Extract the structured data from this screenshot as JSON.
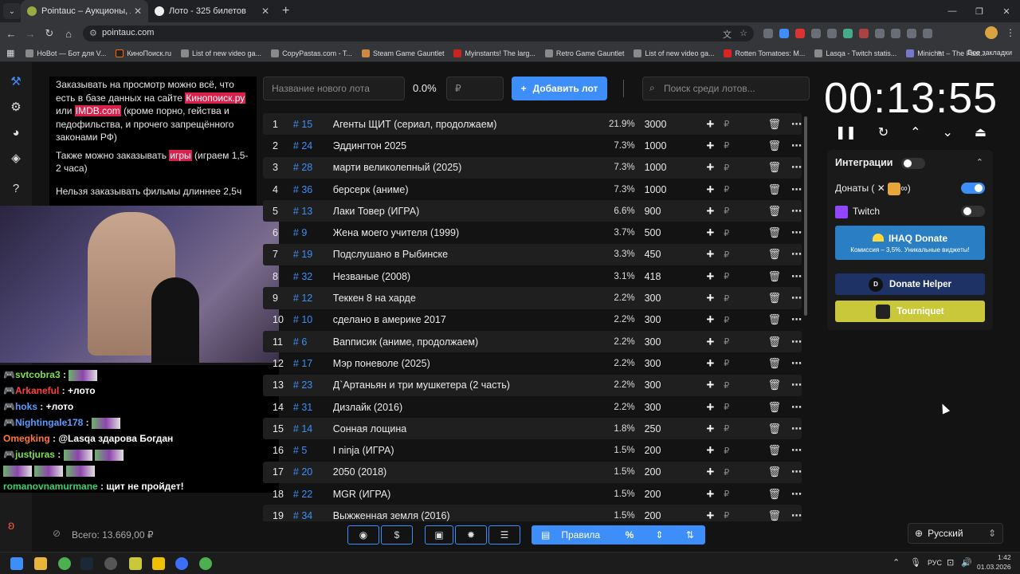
{
  "browser": {
    "tabs": [
      {
        "title": "Pointauc – Аукционы, лотереи",
        "active": true
      },
      {
        "title": "Лото - 325 билетов",
        "active": false
      }
    ],
    "new_tab": "+",
    "url": "pointauc.com",
    "bookmarks": [
      "HoBot — Бот для V...",
      "КиноПоиск.ru",
      "List of new video ga...",
      "CopyPastas.com - T...",
      "Steam Game Gauntlet",
      "Myinstants! The larg...",
      "Retro Game Gauntlet",
      "List of new video ga...",
      "Rotten Tomatoes: M...",
      "Lasqa - Twitch statis...",
      "Minichat – The Fast..."
    ],
    "all_bookmarks": "Все закладки"
  },
  "rules_panel": {
    "p1_before": "Заказывать на просмотр можно всё, что есть в базе данных на сайте ",
    "p1_link1": "Кинопоиск.ру",
    "p1_mid": " или ",
    "p1_link2": "IMDB.com",
    "p1_after": " (кроме порно, гейства и педофильства, и прочего запрещённого законами РФ)",
    "p2_before": "Также можно заказывать ",
    "p2_link": "игры",
    "p2_after": " (играем 1,5-2 часа)",
    "p3": "Нельзя заказывать фильмы длиннее 2,5ч"
  },
  "chat": [
    {
      "user": "svtcobra3",
      "color": "#7fe04d",
      "msg": ""
    },
    {
      "user": "Arkaneful",
      "color": "#ff4040",
      "msg": "+лото"
    },
    {
      "user": "hoks",
      "color": "#5a9cff",
      "msg": "+лото"
    },
    {
      "user": "Nightingale178",
      "color": "#5a9cff",
      "msg": ""
    },
    {
      "user": "Omegking",
      "color": "#ff7a30",
      "msg": "@Lasqa здарова Богдан"
    },
    {
      "user": "justjuras",
      "color": "#7fe04d",
      "msg": ""
    },
    {
      "user": "romanovnamurmane",
      "color": "#3cd070",
      "msg": "щит не пройдет!"
    }
  ],
  "top_controls": {
    "new_lot_placeholder": "Название нового лота",
    "percent": "0.0%",
    "amount_placeholder": "₽",
    "add_lot": "Добавить лот",
    "search_placeholder": "Поиск среди лотов..."
  },
  "lots": [
    {
      "n": "1",
      "id": "# 15",
      "name": "Агенты ЩИТ (сериал, продолжаем)",
      "pct": "21.9%",
      "amount": "3000"
    },
    {
      "n": "2",
      "id": "# 24",
      "name": "Эддингтон 2025",
      "pct": "7.3%",
      "amount": "1000"
    },
    {
      "n": "3",
      "id": "# 28",
      "name": "марти великолепный (2025)",
      "pct": "7.3%",
      "amount": "1000"
    },
    {
      "n": "4",
      "id": "# 36",
      "name": "берсерк (аниме)",
      "pct": "7.3%",
      "amount": "1000"
    },
    {
      "n": "5",
      "id": "# 13",
      "name": "Лаки Товер (ИГРА)",
      "pct": "6.6%",
      "amount": "900"
    },
    {
      "n": "6",
      "id": "# 9",
      "name": "Жена моего учителя (1999)",
      "pct": "3.7%",
      "amount": "500"
    },
    {
      "n": "7",
      "id": "# 19",
      "name": "Подслушано в Рыбинске",
      "pct": "3.3%",
      "amount": "450"
    },
    {
      "n": "8",
      "id": "# 32",
      "name": "Незваные (2008)",
      "pct": "3.1%",
      "amount": "418"
    },
    {
      "n": "9",
      "id": "# 12",
      "name": "Теккен 8 на харде",
      "pct": "2.2%",
      "amount": "300"
    },
    {
      "n": "10",
      "id": "# 10",
      "name": "сделано в америке 2017",
      "pct": "2.2%",
      "amount": "300"
    },
    {
      "n": "11",
      "id": "# 6",
      "name": "Вanписик (аниме, продолжаем)",
      "pct": "2.2%",
      "amount": "300"
    },
    {
      "n": "12",
      "id": "# 17",
      "name": "Мэр поневоле (2025)",
      "pct": "2.2%",
      "amount": "300"
    },
    {
      "n": "13",
      "id": "# 23",
      "name": "Д`Артаньян и три мушкетера (2 часть)",
      "pct": "2.2%",
      "amount": "300"
    },
    {
      "n": "14",
      "id": "# 31",
      "name": "Дизлайк (2016)",
      "pct": "2.2%",
      "amount": "300"
    },
    {
      "n": "15",
      "id": "# 14",
      "name": "Сонная лощина",
      "pct": "1.8%",
      "amount": "250"
    },
    {
      "n": "16",
      "id": "# 5",
      "name": "I ninja (ИГРА)",
      "pct": "1.5%",
      "amount": "200"
    },
    {
      "n": "17",
      "id": "# 20",
      "name": "2050 (2018)",
      "pct": "1.5%",
      "amount": "200"
    },
    {
      "n": "18",
      "id": "# 22",
      "name": "MGR (ИГРА)",
      "pct": "1.5%",
      "amount": "200"
    },
    {
      "n": "19",
      "id": "# 34",
      "name": "Выжженная земля (2016)",
      "pct": "1.5%",
      "amount": "200"
    }
  ],
  "row_icons": {
    "plus": "+",
    "currency": "₽",
    "trash": "🗑",
    "more": "⋯"
  },
  "timer": {
    "display": "00:13:55"
  },
  "integrations": {
    "title": "Интеграции",
    "donations_label": "Донаты (",
    "donations_close": ")",
    "twitch_label": "Twitch",
    "ihaq_title": "IHAQ Donate",
    "ihaq_sub": "Комиссия – 3,5%. Уникальные виджеты!",
    "donate_helper": "Donate Helper",
    "tourniquet": "Tourniquet"
  },
  "footer": {
    "total": "Всего: 13.669,00 ₽",
    "rules_button": "Правила",
    "percent_button": "%",
    "language": "Русский"
  },
  "taskbar": {
    "lang": "РУС",
    "time": "1:42",
    "date": "01.03.2026"
  },
  "colors": {
    "accent": "#3d8ef8",
    "highlight": "#d8204a",
    "tourniquet": "#c8c83a",
    "ihaq": "#2a7fc4",
    "helper": "#1e3266"
  }
}
